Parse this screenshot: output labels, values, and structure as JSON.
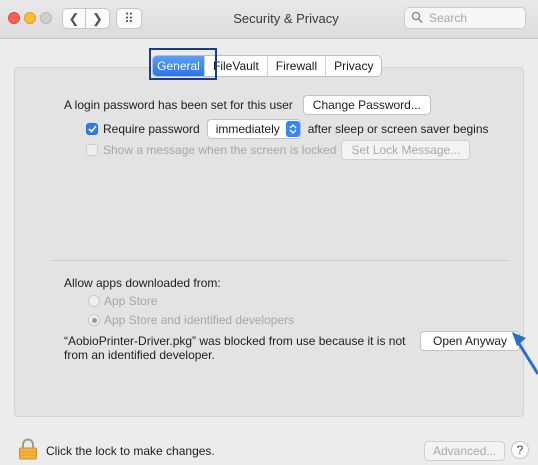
{
  "window": {
    "title": "Security & Privacy",
    "search_placeholder": "Search",
    "back_glyph": "❮",
    "forward_glyph": "❯",
    "grid_glyph": "⠿"
  },
  "tabs": [
    {
      "label": "General",
      "active": true
    },
    {
      "label": "FileVault",
      "active": false
    },
    {
      "label": "Firewall",
      "active": false
    },
    {
      "label": "Privacy",
      "active": false
    }
  ],
  "login": {
    "text": "A login password has been set for this user",
    "change_password_button": "Change Password...",
    "require_password_label": "Require password",
    "require_password_checked": true,
    "require_password_value": "immediately",
    "after_sleep_text": "after sleep or screen saver begins",
    "show_message_label": "Show a message when the screen is locked",
    "show_message_checked": false,
    "set_lock_message_button": "Set Lock Message..."
  },
  "downloads": {
    "heading": "Allow apps downloaded from:",
    "options": [
      {
        "label": "App Store",
        "selected": false
      },
      {
        "label": "App Store and identified developers",
        "selected": true
      }
    ],
    "blocked_line1": "“AobioPrinter-Driver.pkg” was blocked from use because it is not",
    "blocked_line2": "from an identified developer.",
    "open_anyway_button": "Open Anyway"
  },
  "footer": {
    "lock_text": "Click the lock to make changes.",
    "advanced_button": "Advanced...",
    "help_glyph": "?"
  },
  "colors": {
    "accent": "#2f7cf0",
    "highlight_box": "#1a3c8a",
    "arrow": "#2a6fc9"
  }
}
